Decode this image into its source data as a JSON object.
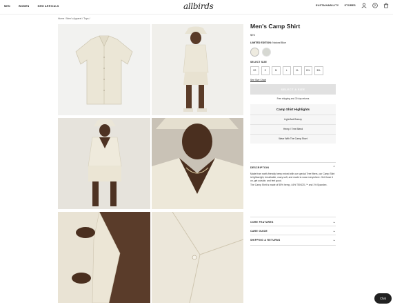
{
  "nav": {
    "links": [
      "MEN",
      "WOMEN",
      "NEW ARRIVALS"
    ],
    "logo": "allbirds",
    "right_links": [
      "SUSTAINABILITY",
      "STORES"
    ],
    "icons": [
      "user-icon",
      "help-icon",
      "cart-icon"
    ]
  },
  "breadcrumb": "Home / Men's Apparel / Tops /",
  "product": {
    "title": "Men's Camp Shirt",
    "price": "$75",
    "edition_label": "LIMITED EDITION:",
    "edition_value": "Natural Blue",
    "colors": [
      "#eeebe0",
      "#d6d8d2"
    ],
    "select_size_label": "SELECT SIZE",
    "sizes": [
      "XS",
      "S",
      "M",
      "L",
      "XL",
      "2XL",
      "3XL"
    ],
    "size_chart": "See Size Chart",
    "add_button": "SELECT A SIZE",
    "shipping_note": "Free shipping and 30 day returns"
  },
  "highlights": {
    "title": "Camp Shirt Highlights",
    "items": [
      "Light And Breezy",
      "Hemp / Tree Blend",
      "Wear With The Camp Short"
    ]
  },
  "accordion": {
    "description_label": "DESCRIPTION",
    "description_text": "Made from earth-friendly hemp mixed with our special Tree fibers, our Camp Shirt is lightweight, breathable, crazy soft, and made to wow everywhere. Get those it on, get outside, and feel good.",
    "material_text": "The Camp Shirt is made of 55% hemp, 44% TENCEL™ and 1% Spandex.",
    "core_features": "CORE FEATURES",
    "care_guide": "CARE GUIDE",
    "shipping_returns": "SHIPPING & RETURNS"
  },
  "chat": "Chat"
}
